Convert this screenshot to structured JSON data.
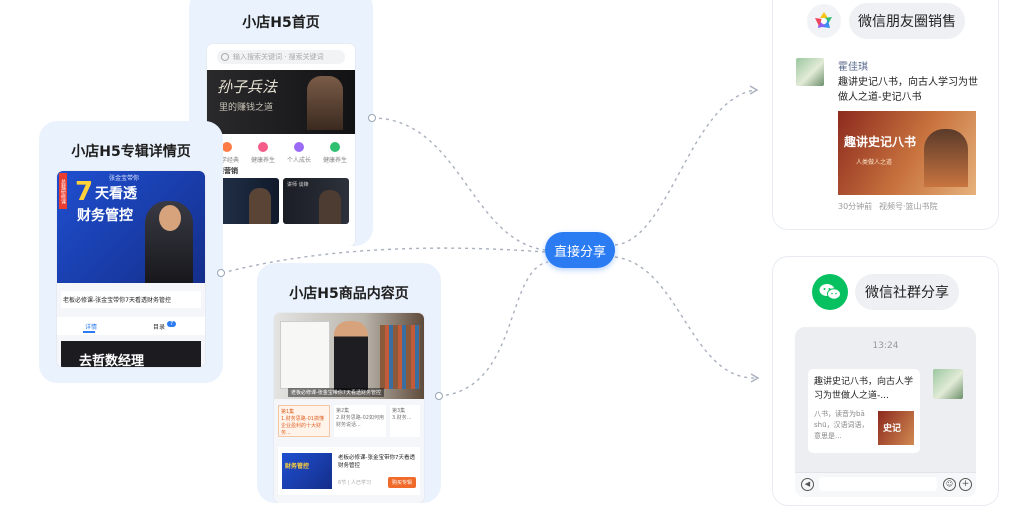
{
  "hub": {
    "label": "直接分享"
  },
  "home": {
    "title": "小店H5首页",
    "search_placeholder": "输入搜索关键词 · 搜索关键词",
    "banner_line1": "孙子兵法",
    "banner_line2": "里的赚钱之道",
    "icons": [
      "国学经典",
      "健康养生",
      "个人成长",
      "健康养生"
    ],
    "section_label": "课营销",
    "course_tag": "讲师 谈锋"
  },
  "album": {
    "title": "小店H5专辑详情页",
    "badge": "总裁研修课",
    "big_number": "7",
    "headline1": "天看透",
    "headline2": "财务管控",
    "speaker": "张金宝带你",
    "caption": "老板必修课-张金宝带你7天看透财务管控",
    "tab_detail": "详情",
    "tab_catalog": "目录",
    "catalog_count": "7",
    "footer_text": "去哲数经理"
  },
  "product": {
    "title": "小店H5商品内容页",
    "video_caption": "老板必修课-张金宝带你7天看透财务管控",
    "chapters": [
      {
        "tag": "第1集",
        "text": "1.财务思路-01搞懂企业盈利的十大财务..."
      },
      {
        "tag": "第2集",
        "text": "2.财务思路-02如何用财务说话..."
      },
      {
        "tag": "第3集",
        "text": "3.财务..."
      }
    ],
    "course_title": "老板必修课-张金宝带你7天看透财务管控",
    "course_meta": "6节 | 人已学习",
    "buy_label": "购买专辑",
    "thumb_badge": "财务管控"
  },
  "moments": {
    "pill_label": "微信朋友圈销售",
    "user_name": "霍佳琪",
    "post_text": "趣讲史记八书，向古人学习为世做人之道-史记八书",
    "image_title": "趣讲史记八书",
    "image_sub": "人类做人之道",
    "time": "30分钟前",
    "source": "视频号·篮山书院"
  },
  "group": {
    "pill_label": "微信社群分享",
    "time": "13:24",
    "card_title": "趣讲史记八书，向古人学习为世做人之道-...",
    "card_desc": "八书，读音为bā shū，汉语词语，意思是...",
    "thumb_label": "史记"
  },
  "colors": {
    "accent": "#2b7cf3",
    "card_bg": "#eaf2fd",
    "wechat_green": "#07c160",
    "orange": "#f08030"
  }
}
